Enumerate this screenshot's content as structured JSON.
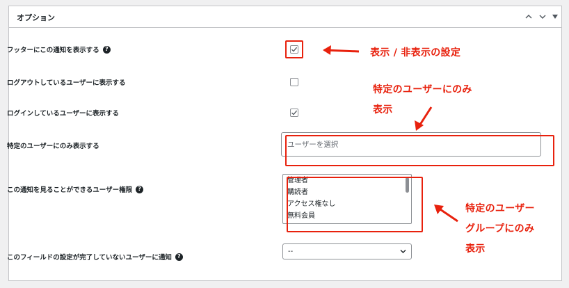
{
  "panel": {
    "title": "オプション",
    "controls": [
      "chevron-up-icon",
      "chevron-down-icon",
      "triangle-toggle-icon"
    ]
  },
  "rows": {
    "footer_display": {
      "label": "フッターにこの通知を表示する",
      "help": "?",
      "checked": true
    },
    "logged_out": {
      "label": "ログアウトしているユーザーに表示する",
      "checked": false
    },
    "logged_in": {
      "label": "ログインしているユーザーに表示する",
      "checked": true
    },
    "specific_users": {
      "label": "特定のユーザーにのみ表示する",
      "placeholder": "ユーザーを選択"
    },
    "roles": {
      "label": "この通知を見ることができるユーザー権限",
      "help": "?",
      "options": [
        "管理者",
        "購読者",
        "アクセス権なし",
        "無料会員"
      ]
    },
    "incomplete_fields": {
      "label": "このフィールドの設定が完了していないユーザーに通知",
      "help": "?",
      "selected": "--"
    }
  },
  "annotations": {
    "toggle": "表示 / 非表示の設定",
    "specific_line1": "特定のユーザーにのみ",
    "specific_line2": "表示",
    "group_line1": "特定のユーザー",
    "group_line2": "グループにのみ",
    "group_line3": "表示"
  },
  "colors": {
    "annotation": "#e8210d",
    "border": "#c3c4c7",
    "background": "#f0f0f1"
  }
}
